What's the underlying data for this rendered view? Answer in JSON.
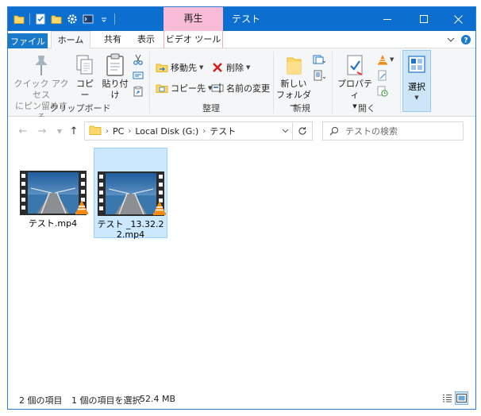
{
  "window": {
    "title": "テスト",
    "context_tab": "再生"
  },
  "ribbon_tabs": {
    "file": "ファイル",
    "home": "ホーム",
    "share": "共有",
    "view": "表示",
    "video_tools": "ビデオ ツール"
  },
  "clipboard": {
    "pin_line1": "クイック アクセス",
    "pin_line2": "にピン留めする",
    "copy": "コピー",
    "paste": "貼り付け",
    "group": "クリップボード"
  },
  "organize": {
    "move_to": "移動先",
    "copy_to": "コピー先",
    "delete": "削除",
    "rename": "名前の変更",
    "group": "整理"
  },
  "new": {
    "new_folder_line1": "新しい",
    "new_folder_line2": "フォルダー",
    "group": "新規"
  },
  "open": {
    "properties": "プロパティ",
    "group": "開く"
  },
  "select": {
    "label": "選択"
  },
  "address": {
    "crumbs": [
      "PC",
      "Local Disk (G:)",
      "テスト"
    ]
  },
  "search": {
    "placeholder": "テストの検索"
  },
  "files": [
    {
      "name": "テスト.mp4",
      "selected": false
    },
    {
      "name": "テスト _13.32.22.mp4",
      "selected": true
    }
  ],
  "status": {
    "count": "2 個の項目",
    "selection": "1 個の項目を選択",
    "size": "52.4 MB"
  },
  "colors": {
    "titlebar": "#0c6fd0",
    "context_tab": "#f8bcd9",
    "selection": "#cce8ff"
  }
}
